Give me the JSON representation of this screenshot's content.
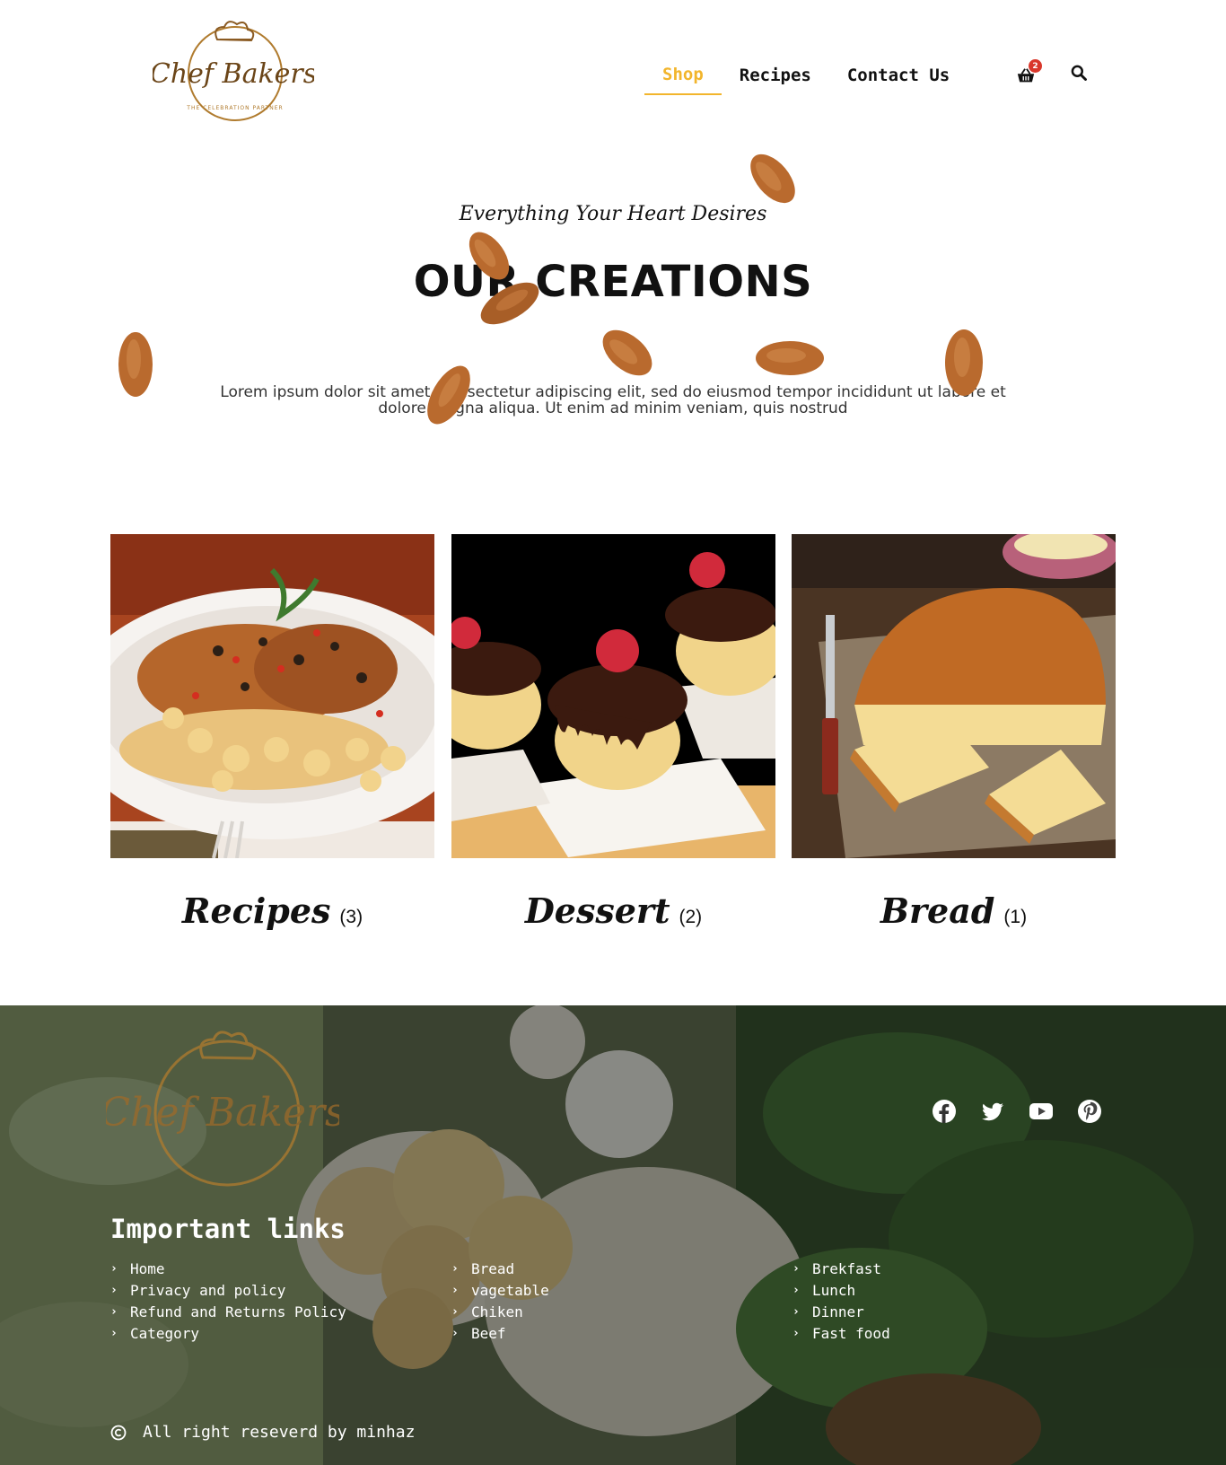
{
  "header": {
    "logo_text": "Chef Bakers",
    "logo_subtext": "THE CELEBRATION PARTNER",
    "nav": [
      {
        "label": "Shop",
        "active": true
      },
      {
        "label": "Recipes",
        "active": false
      },
      {
        "label": "Contact Us",
        "active": false
      }
    ],
    "cart_count": "2",
    "cart_icon": "basket-icon",
    "search_icon": "search-icon"
  },
  "hero": {
    "tagline": "Everything Your Heart Desires",
    "title": "OUR CREATIONS",
    "description_line1": "Lorem ipsum dolor sit amet, consectetur adipiscing elit, sed do eiusmod tempor incididunt ut labore et",
    "description_line2": "dolore magna aliqua. Ut enim ad minim veniam, quis nostrud"
  },
  "categories": [
    {
      "name": "Recipes",
      "count": "(3)",
      "image": "chicken-pasta-dish"
    },
    {
      "name": "Dessert",
      "count": "(2)",
      "image": "chocolate-raspberry-cupcakes"
    },
    {
      "name": "Bread",
      "count": "(1)",
      "image": "bread-loaf-on-board"
    }
  ],
  "footer": {
    "logo_text": "Chef Bakers",
    "socials": [
      "facebook-icon",
      "twitter-icon",
      "youtube-icon",
      "pinterest-icon"
    ],
    "links_title": "Important links",
    "link_columns": [
      [
        "Home",
        "Privacy and policy",
        "Refund and Returns Policy",
        "Category"
      ],
      [
        "Bread",
        "vagetable",
        "Chiken",
        "Beef"
      ],
      [
        "Brekfast",
        "Lunch",
        "Dinner",
        "Fast food"
      ]
    ],
    "copyright": "All right reseverd by minhaz"
  },
  "colors": {
    "accent": "#f2b52c",
    "logo_gold": "#b07b2e",
    "badge": "#d9372b",
    "almond": "#b96a2e"
  }
}
